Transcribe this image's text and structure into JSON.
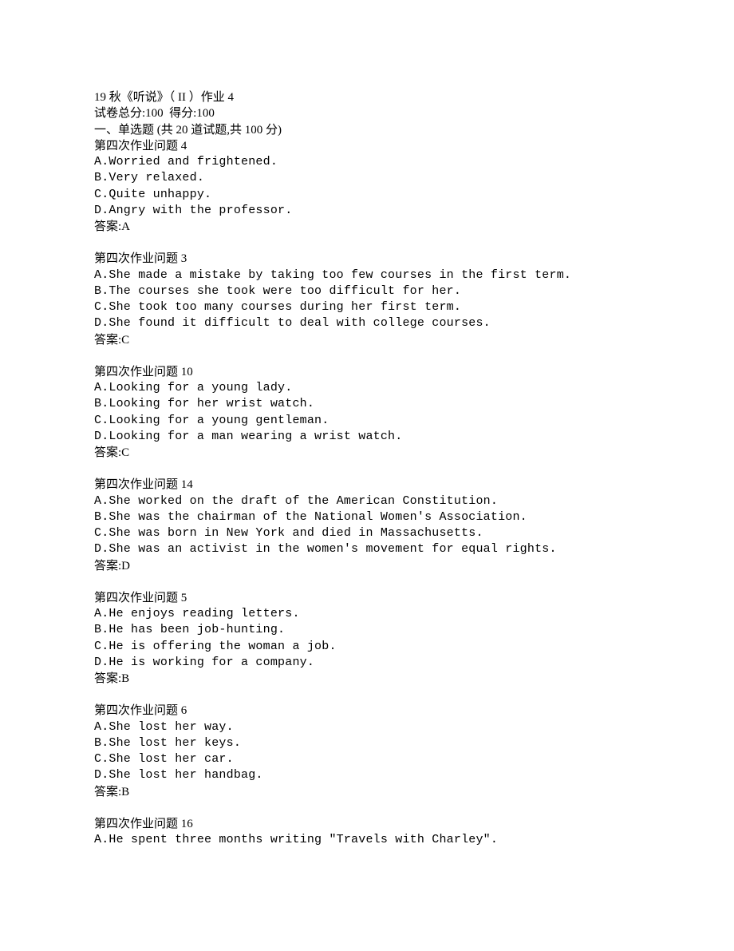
{
  "header": {
    "title": "19 秋《听说》（ II ）作业 4",
    "total_line": "试卷总分:100  得分:100",
    "section_title": "一、单选题 (共 20 道试题,共 100 分)"
  },
  "questions": [
    {
      "title": "第四次作业问题 4",
      "options": [
        "A.Worried and frightened.",
        "B.Very relaxed.",
        "C.Quite unhappy.",
        "D.Angry with the professor."
      ],
      "answer": "答案:A"
    },
    {
      "title": "第四次作业问题 3",
      "options": [
        "A.She made a mistake by taking too few courses in the first term.",
        "B.The courses she took were too difficult for her.",
        "C.She took too many courses during her first term.",
        "D.She found it difficult to deal with college courses."
      ],
      "answer": "答案:C"
    },
    {
      "title": "第四次作业问题 10",
      "options": [
        "A.Looking for a young lady.",
        "B.Looking for her wrist watch.",
        "C.Looking for a young gentleman.",
        "D.Looking for a man wearing a wrist watch."
      ],
      "answer": "答案:C"
    },
    {
      "title": "第四次作业问题 14",
      "options": [
        "A.She worked on the draft of the American Constitution.",
        "B.She was the chairman of the National Women's Association.",
        "C.She was born in New York and died in Massachusetts.",
        "D.She was an activist in the women's movement for equal rights."
      ],
      "answer": "答案:D"
    },
    {
      "title": "第四次作业问题 5",
      "options": [
        "A.He enjoys reading letters.",
        "B.He has been job-hunting.",
        "C.He is offering the woman a job.",
        "D.He is working for a company."
      ],
      "answer": "答案:B"
    },
    {
      "title": "第四次作业问题 6",
      "options": [
        "A.She lost her way.",
        "B.She lost her keys.",
        "C.She lost her car.",
        "D.She lost her handbag."
      ],
      "answer": "答案:B"
    },
    {
      "title": "第四次作业问题 16",
      "options": [
        "A.He spent three months writing \"Travels with Charley\"."
      ],
      "answer": ""
    }
  ]
}
